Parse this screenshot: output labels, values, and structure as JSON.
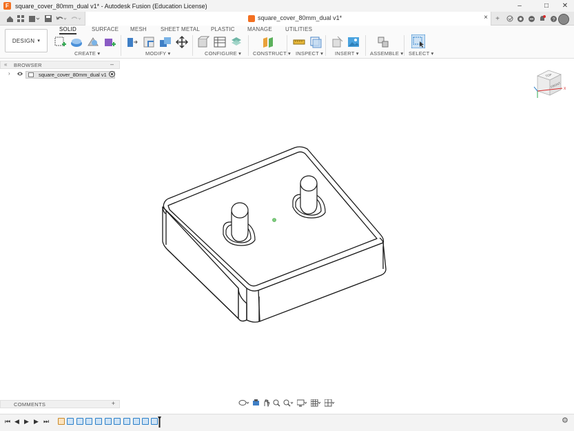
{
  "window": {
    "title": "square_cover_80mm_dual v1* - Autodesk Fusion (Education License)"
  },
  "document_tab": {
    "title": "square_cover_80mm_dual v1*",
    "close": "×"
  },
  "window_controls": {
    "minimize": "–",
    "maximize": "□",
    "close": "✕"
  },
  "tab_actions": {
    "new_tab": "+",
    "close": "✕"
  },
  "ribbon": {
    "workspace": "DESIGN",
    "workspace_caret": "▾",
    "tabs": [
      "SOLID",
      "SURFACE",
      "MESH",
      "SHEET METAL",
      "PLASTIC",
      "MANAGE",
      "UTILITIES"
    ],
    "groups": [
      "CREATE",
      "MODIFY",
      "CONFIGURE",
      "CONSTRUCT",
      "INSPECT",
      "INSERT",
      "ASSEMBLE",
      "SELECT"
    ]
  },
  "browser": {
    "label": "BROWSER",
    "component": "square_cover_80mm_dual v1"
  },
  "comments": {
    "label": "COMMENTS",
    "add": "+"
  },
  "viewcube": {
    "top": "TOP",
    "front": "FRONT"
  },
  "colors": {
    "ribbon_bg": "#fafafa",
    "accent": "#2a7fc9",
    "brand": "#f37021",
    "model_stroke": "#1a1a1a"
  }
}
